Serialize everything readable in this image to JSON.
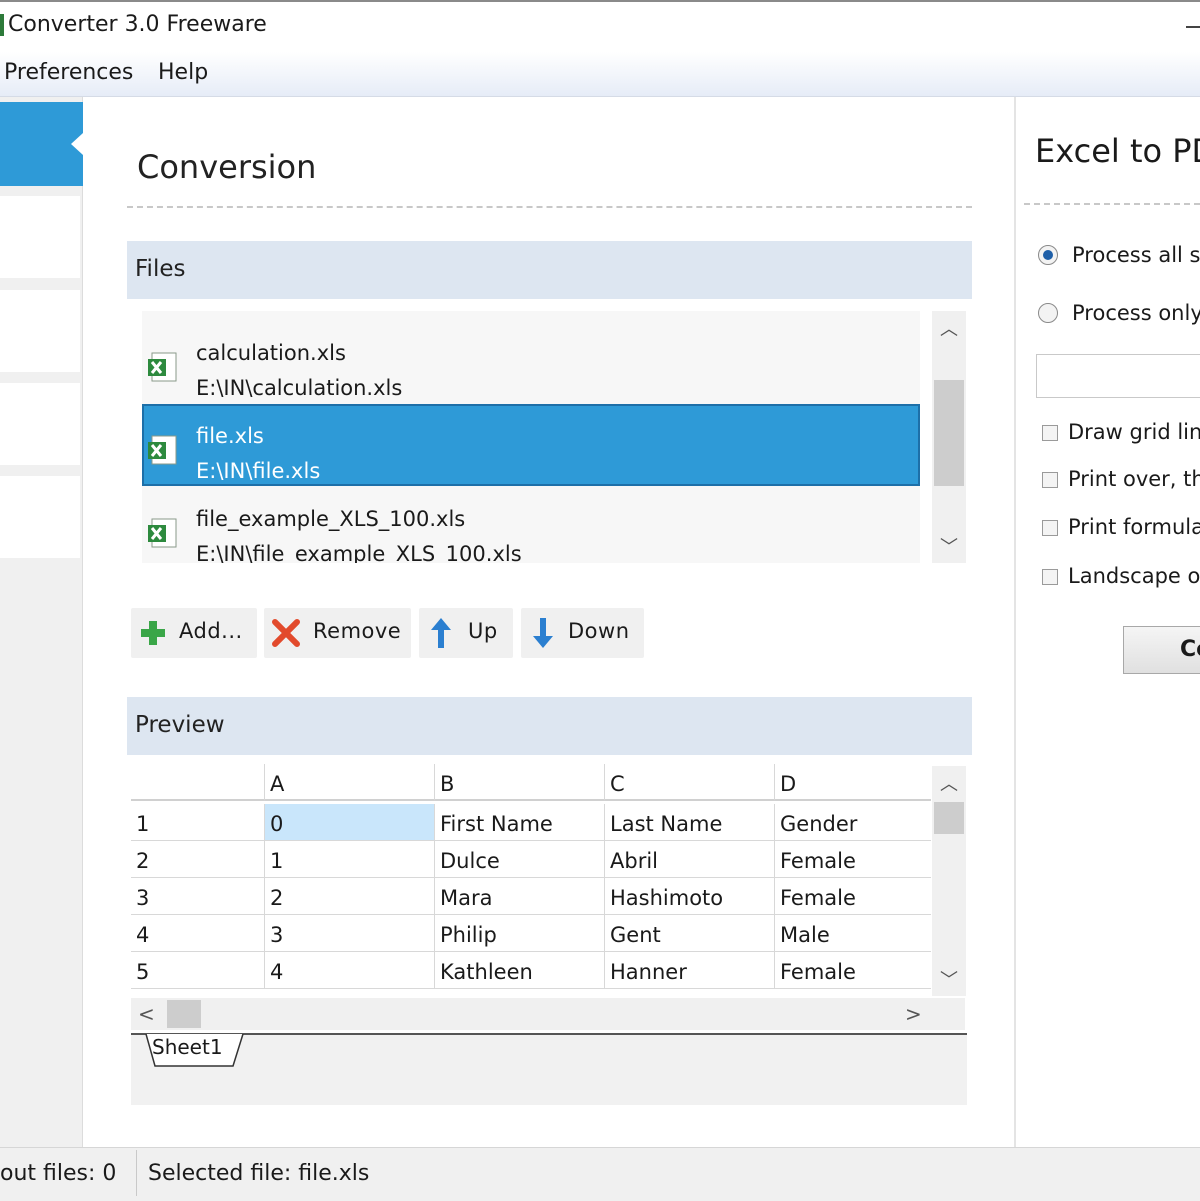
{
  "window": {
    "title": "Converter 3.0 Freeware"
  },
  "menu": {
    "items": [
      "Preferences",
      "Help"
    ]
  },
  "main": {
    "title": "Conversion",
    "files_header": "Files",
    "files": [
      {
        "name": "calculation.xls",
        "path": "E:\\IN\\calculation.xls",
        "selected": false
      },
      {
        "name": "file.xls",
        "path": "E:\\IN\\file.xls",
        "selected": true
      },
      {
        "name": "file_example_XLS_100.xls",
        "path": "E:\\IN\\file_example_XLS_100.xls",
        "selected": false
      }
    ],
    "buttons": {
      "add": "Add...",
      "remove": "Remove",
      "up": "Up",
      "down": "Down"
    },
    "preview_header": "Preview",
    "grid": {
      "columns": [
        "A",
        "B",
        "C",
        "D"
      ],
      "rows": [
        {
          "num": "1",
          "cells": [
            "0",
            "First Name",
            "Last Name",
            "Gender"
          ]
        },
        {
          "num": "2",
          "cells": [
            "1",
            "Dulce",
            "Abril",
            "Female"
          ]
        },
        {
          "num": "3",
          "cells": [
            "2",
            "Mara",
            "Hashimoto",
            "Female"
          ]
        },
        {
          "num": "4",
          "cells": [
            "3",
            "Philip",
            "Gent",
            "Male"
          ]
        },
        {
          "num": "5",
          "cells": [
            "4",
            "Kathleen",
            "Hanner",
            "Female"
          ]
        }
      ],
      "selected_cell": "A1"
    },
    "sheet_tab": "Sheet1"
  },
  "right_panel": {
    "title": "Excel to PD",
    "radio_all": "Process all sh",
    "radio_only": "Process only",
    "checks": [
      "Draw grid line",
      "Print over, th",
      "Print formula",
      "Landscape or"
    ],
    "convert_label": "Co"
  },
  "status": {
    "output_files": "out files: 0",
    "selected_file": "Selected file: file.xls"
  },
  "colors": {
    "accent": "#2e9ad7",
    "section_bg": "#dde6f1",
    "excel_green": "#2d8a3e"
  }
}
